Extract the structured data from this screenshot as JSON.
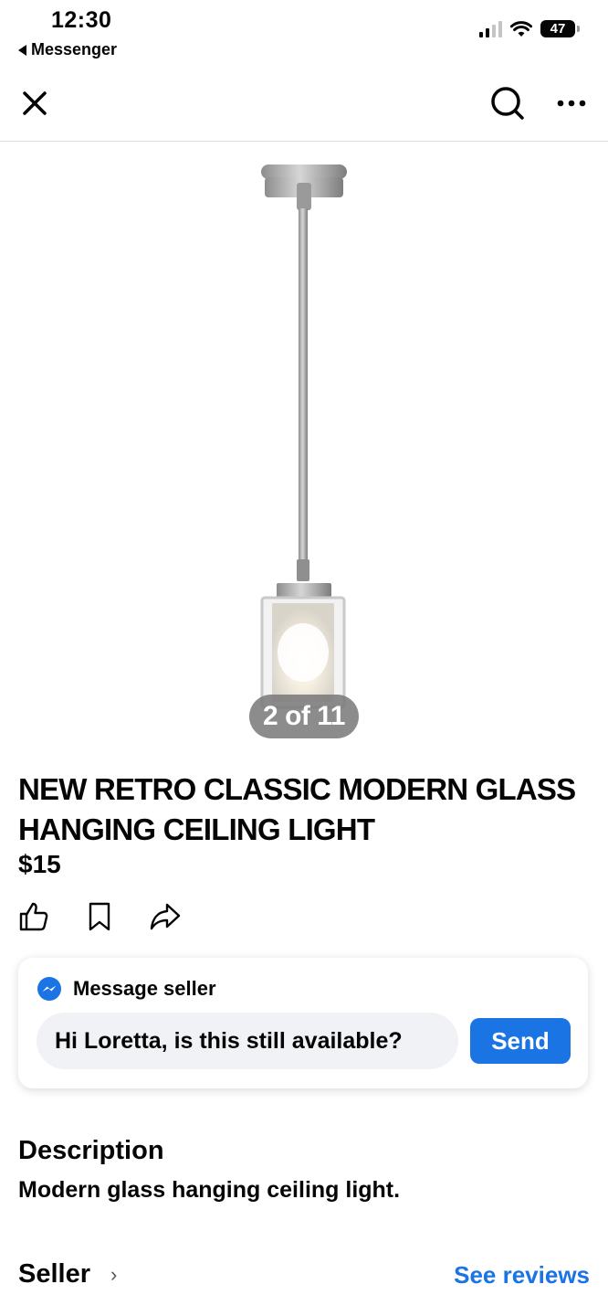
{
  "status_bar": {
    "time": "12:30",
    "back_app": "Messenger",
    "battery": "47"
  },
  "header": {
    "close_icon": "close-icon",
    "search_icon": "search-icon",
    "more_icon": "more-horizontal-icon"
  },
  "photo": {
    "counter": "2 of 11"
  },
  "listing": {
    "title": "NEW RETRO CLASSIC MODERN GLASS HANGING CEILING LIGHT",
    "price": "$15",
    "actions": [
      "like-icon",
      "save-icon",
      "share-icon"
    ]
  },
  "message_card": {
    "heading": "Message seller",
    "input_value": "Hi Loretta, is this still available?",
    "send_label": "Send"
  },
  "description": {
    "heading": "Description",
    "text": "Modern glass hanging ceiling light."
  },
  "seller": {
    "label": "Seller",
    "see_reviews": "See reviews"
  },
  "colors": {
    "accent": "#1b74e4",
    "text": "#050505",
    "input_bg": "#f0f2f5"
  }
}
